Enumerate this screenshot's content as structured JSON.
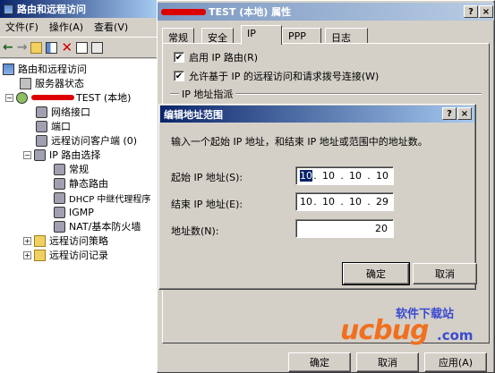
{
  "left_window": {
    "title": "路由和远程访问",
    "menu": [
      "文件(F)",
      "操作(A)",
      "查看(V)"
    ],
    "tree": {
      "root": "路由和远程访问",
      "server_status": "服务器状态",
      "server": "TEST (本地)",
      "network_interfaces": "网络接口",
      "ports": "端口",
      "remote_clients": "远程访问客户端 (0)",
      "ip_routing": "IP 路由选择",
      "general": "常规",
      "static_routes": "静态路由",
      "dhcp_relay": "DHCP 中继代理程序",
      "igmp": "IGMP",
      "nat": "NAT/基本防火墙",
      "remote_policy": "远程访问策略",
      "remote_log": "远程访问记录"
    }
  },
  "props_window": {
    "title": "TEST (本地) 属性",
    "help_btn": "?",
    "close_btn": "×",
    "tabs": [
      "常规",
      "安全",
      "IP",
      "PPP",
      "日志"
    ],
    "enable_ip_routing": "启用 IP 路由(R)",
    "allow_ip_remote": "允许基于 IP 的远程访问和请求拨号连接(W)",
    "group_label": "IP 地址指派",
    "ok": "确定",
    "cancel": "取消",
    "apply": "应用(A)"
  },
  "dialog": {
    "title": "编辑地址范围",
    "help_btn": "?",
    "close_btn": "×",
    "description": "输入一个起始 IP 地址，和结束 IP 地址或范围中的地址数。",
    "start_label": "起始 IP 地址(S):",
    "end_label": "结束 IP 地址(E):",
    "count_label": "地址数(N):",
    "start_ip": [
      "10",
      "10",
      "10",
      "10"
    ],
    "end_ip": [
      "10",
      "10",
      "10",
      "29"
    ],
    "count": "20",
    "ok": "确定",
    "cancel": "取消"
  },
  "watermark": {
    "brand": "ucbug",
    "tld": ".com",
    "tagline": "软件下载站"
  }
}
